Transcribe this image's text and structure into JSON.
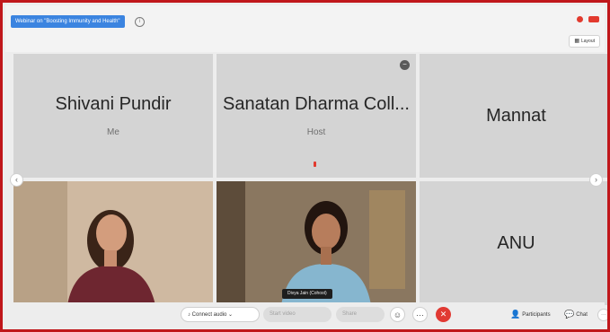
{
  "meeting": {
    "title": "Webinar on \"Boosting Immunity and Health\"",
    "info_icon": "info-icon",
    "recording_indicator_color": "#e23a2e"
  },
  "toolbar_top": {
    "layout_label": "Layout",
    "layout_glyph": "▦"
  },
  "participants": [
    {
      "name": "Shivani Pundir",
      "role": "Me"
    },
    {
      "name": "Sanatan Dharma Coll...",
      "role": "Host"
    },
    {
      "name": "Mannat",
      "role": ""
    },
    {
      "name": "",
      "role": ""
    },
    {
      "name": "",
      "video_label": "Divya Jain (Cohost)"
    },
    {
      "name": "ANU",
      "role": ""
    }
  ],
  "nav": {
    "prev_glyph": "‹",
    "next_glyph": "›"
  },
  "controls": {
    "audio_label": "Connect audio",
    "audio_glyph": "♪",
    "audio_caret": "⌄",
    "video_label": "Start video",
    "share_label": "Share",
    "reactions_glyph": "☺",
    "more_glyph": "···",
    "leave_glyph": "✕",
    "participants_label": "Participants",
    "participants_glyph": "👤",
    "chat_label": "Chat",
    "chat_glyph": "💬",
    "overflow_glyph": "···"
  },
  "colors": {
    "border": "#c0171b",
    "accent": "#3b84e0",
    "leave": "#e13a33"
  }
}
